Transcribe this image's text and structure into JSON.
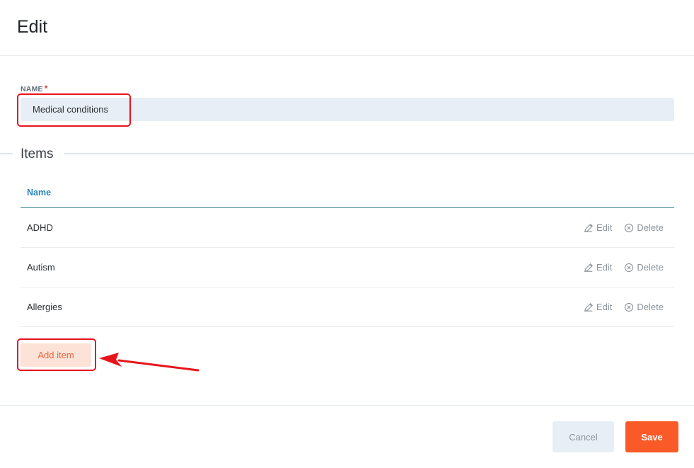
{
  "dialog": {
    "title": "Edit"
  },
  "name_field": {
    "label": "NAME",
    "required_mark": "*",
    "value": "Medical conditions"
  },
  "items_section": {
    "title": "Items",
    "column_header": "Name",
    "rows": [
      {
        "name": "ADHD",
        "edit_label": "Edit",
        "delete_label": "Delete"
      },
      {
        "name": "Autism",
        "edit_label": "Edit",
        "delete_label": "Delete"
      },
      {
        "name": "Allergies",
        "edit_label": "Edit",
        "delete_label": "Delete"
      }
    ],
    "add_item_label": "Add item"
  },
  "footer": {
    "cancel_label": "Cancel",
    "save_label": "Save"
  },
  "icons": {
    "edit": "pencil-icon",
    "delete": "circle-x-icon"
  },
  "colors": {
    "accent": "#fa5a28",
    "header_blue": "#2a86b8",
    "annotation_red": "#e8141b"
  }
}
